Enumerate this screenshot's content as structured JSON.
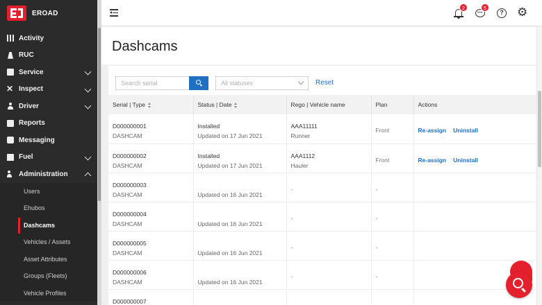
{
  "brand": {
    "name": "EROAD"
  },
  "nav": [
    {
      "label": "Activity",
      "icon": "activity-icon",
      "expandable": false
    },
    {
      "label": "RUC",
      "icon": "ruc-icon",
      "expandable": false
    },
    {
      "label": "Service",
      "icon": "service-icon",
      "expandable": true
    },
    {
      "label": "Inspect",
      "icon": "inspect-icon",
      "expandable": true
    },
    {
      "label": "Driver",
      "icon": "driver-icon",
      "expandable": true
    },
    {
      "label": "Reports",
      "icon": "reports-icon",
      "expandable": false
    },
    {
      "label": "Messaging",
      "icon": "messaging-icon",
      "expandable": false
    },
    {
      "label": "Fuel",
      "icon": "fuel-icon",
      "expandable": true
    },
    {
      "label": "Administration",
      "icon": "administration-icon",
      "expandable": true,
      "expanded": true
    }
  ],
  "admin_sub": [
    {
      "label": "Users"
    },
    {
      "label": "Ehubos"
    },
    {
      "label": "Dashcams",
      "active": true
    },
    {
      "label": "Vehicles / Assets"
    },
    {
      "label": "Asset Attributes"
    },
    {
      "label": "Groups (Fleets)"
    },
    {
      "label": "Vehicle Profiles"
    }
  ],
  "header": {
    "notifications_count": "2",
    "messages_count": "5",
    "help_symbol": "?"
  },
  "page": {
    "title": "Dashcams"
  },
  "filters": {
    "search_placeholder": "Search serial",
    "status_placeholder": "All statuses",
    "reset_label": "Reset"
  },
  "table": {
    "headers": [
      "Serial  |  Type",
      "Status  |  Date",
      "Rego  |  Vehicle name",
      "Plan",
      "Actions"
    ],
    "rows": [
      {
        "serial": "D000000001",
        "type": "DASHCAM",
        "status": "Installed",
        "date": "Updated on 17 Jun 2021",
        "rego": "AAA11111",
        "vehicle": "Runner",
        "plan": "Front",
        "actions": [
          "Re-assign",
          "Uninstall"
        ]
      },
      {
        "serial": "D000000002",
        "type": "DASHCAM",
        "status": "Installed",
        "date": "Updated on 17 Jun 2021",
        "rego": "AAA1112",
        "vehicle": "Hauler",
        "plan": "Front",
        "actions": [
          "Re-assign",
          "Uninstall"
        ]
      },
      {
        "serial": "D000000003",
        "type": "DASHCAM",
        "status": "",
        "date": "Updated on 16 Jun 2021",
        "rego": "-",
        "vehicle": "",
        "plan": "-",
        "actions": []
      },
      {
        "serial": "D000000004",
        "type": "DASHCAM",
        "status": "",
        "date": "Updated on 16 Jun 2021",
        "rego": "-",
        "vehicle": "",
        "plan": "-",
        "actions": []
      },
      {
        "serial": "D000000005",
        "type": "DASHCAM",
        "status": "",
        "date": "Updated on 16 Jun 2021",
        "rego": "-",
        "vehicle": "",
        "plan": "-",
        "actions": []
      },
      {
        "serial": "D000000006",
        "type": "DASHCAM",
        "status": "",
        "date": "Updated on 16 Jun 2021",
        "rego": "-",
        "vehicle": "",
        "plan": "-",
        "actions": []
      },
      {
        "serial": "D000000007",
        "type": "",
        "status": "",
        "date": "",
        "rego": "",
        "vehicle": "",
        "plan": "",
        "actions": []
      }
    ]
  },
  "colors": {
    "brand_red": "#e5202e",
    "link_blue": "#1f6fc2",
    "sidebar_bg": "#2b2b2b"
  }
}
